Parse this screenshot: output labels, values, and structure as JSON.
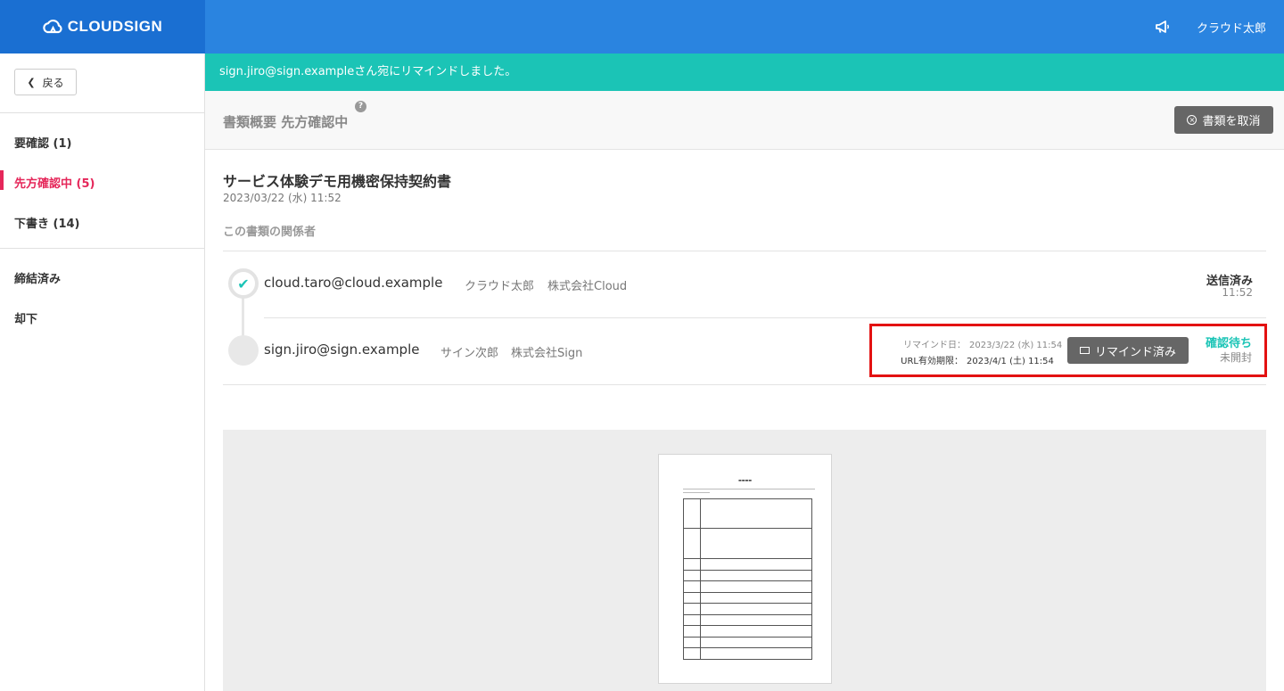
{
  "app": {
    "logo_text": "CLOUDSIGN",
    "user_name": "クラウド太郎",
    "brand_color": "#1a6fd2",
    "header_color": "#2a84e0",
    "accent_teal": "#1bc4b6",
    "accent_red": "#e5275a"
  },
  "sidebar": {
    "back_label": "戻る",
    "items": [
      {
        "label": "要確認 (1)",
        "active": false
      },
      {
        "label": "先方確認中 (5)",
        "active": true
      },
      {
        "label": "下書き (14)",
        "active": false
      },
      {
        "label": "締結済み",
        "active": false
      },
      {
        "label": "却下",
        "active": false
      }
    ]
  },
  "notice": {
    "text": "sign.jiro@sign.exampleさん宛にリマインドしました。"
  },
  "doc_header": {
    "title": "書類概要 先方確認中",
    "help_icon": "?",
    "cancel_label": "書類を取消",
    "cancel_icon": "×"
  },
  "document": {
    "name": "サービス体験デモ用機密保持契約書",
    "date": "2023/03/22 (水) 11:52",
    "parties_title": "この書類の関係者"
  },
  "parties": [
    {
      "email": "cloud.taro@cloud.example",
      "name": "クラウド太郎",
      "company": "株式会社Cloud",
      "status": "送信済み",
      "status_sub": "11:52",
      "node_icon": "✔"
    },
    {
      "email": "sign.jiro@sign.example",
      "name": "サイン次郎",
      "company": "株式会社Sign",
      "status": "確認待ち",
      "status_sub": "未開封",
      "remind_date_label": "リマインド日：",
      "remind_date": "2023/3/22 (水) 11:54",
      "url_expiry_label": "URL有効期限：",
      "url_expiry": "2023/4/1 (土) 11:54",
      "remind_button": "リマインド済み"
    }
  ]
}
